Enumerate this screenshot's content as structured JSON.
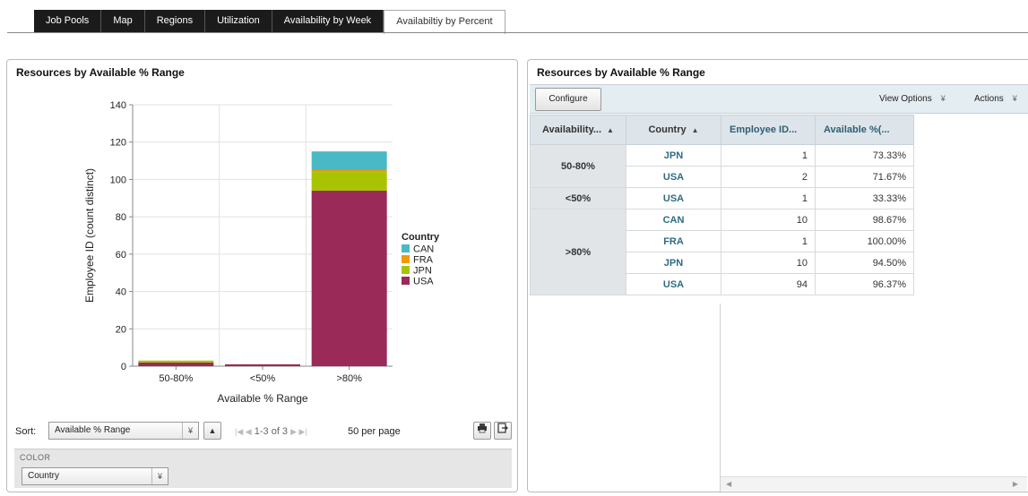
{
  "tabs": [
    {
      "label": "Job Pools"
    },
    {
      "label": "Map"
    },
    {
      "label": "Regions"
    },
    {
      "label": "Utilization"
    },
    {
      "label": "Availability by Week"
    },
    {
      "label": "Availabiltiy by Percent"
    }
  ],
  "left_panel": {
    "title": "Resources by Available % Range",
    "sort_label": "Sort:",
    "sort_value": "Available % Range",
    "pager": {
      "first_prev": "|◀ ◀",
      "range": "1-3 of 3",
      "next_last": "▶ ▶|"
    },
    "per_page": "50 per page",
    "color_label": "COLOR",
    "color_value": "Country"
  },
  "chart_data": {
    "type": "bar",
    "stacked": true,
    "categories": [
      "50-80%",
      "<50%",
      ">80%"
    ],
    "series": [
      {
        "name": "USA",
        "color": "#9a2a57",
        "values": [
          2,
          1,
          94
        ]
      },
      {
        "name": "JPN",
        "color": "#a8c400",
        "values": [
          1,
          0,
          10
        ]
      },
      {
        "name": "FRA",
        "color": "#f29b00",
        "values": [
          0,
          0,
          1
        ]
      },
      {
        "name": "CAN",
        "color": "#4ab9c6",
        "values": [
          0,
          0,
          10
        ]
      }
    ],
    "legend_title": "Country",
    "legend_order": [
      "CAN",
      "FRA",
      "JPN",
      "USA"
    ],
    "legend_placement": "right",
    "xlabel": "Available % Range",
    "ylabel": "Employee ID (count distinct)",
    "yticks": [
      0,
      20,
      40,
      60,
      80,
      100,
      120,
      140
    ],
    "ylim": [
      0,
      140
    ],
    "grid": true
  },
  "right_panel": {
    "title": "Resources by Available % Range",
    "configure_label": "Configure",
    "view_options_label": "View Options",
    "actions_label": "Actions",
    "columns": [
      "Availability...",
      "Country",
      "Employee ID...",
      "Available %(..."
    ],
    "groups": [
      {
        "range": "50-80%",
        "rows": [
          {
            "country": "JPN",
            "count": "1",
            "pct": "73.33%"
          },
          {
            "country": "USA",
            "count": "2",
            "pct": "71.67%"
          }
        ]
      },
      {
        "range": "<50%",
        "rows": [
          {
            "country": "USA",
            "count": "1",
            "pct": "33.33%"
          }
        ]
      },
      {
        "range": ">80%",
        "rows": [
          {
            "country": "CAN",
            "count": "10",
            "pct": "98.67%"
          },
          {
            "country": "FRA",
            "count": "1",
            "pct": "100.00%"
          },
          {
            "country": "JPN",
            "count": "10",
            "pct": "94.50%"
          },
          {
            "country": "USA",
            "count": "94",
            "pct": "96.37%"
          }
        ]
      }
    ]
  }
}
